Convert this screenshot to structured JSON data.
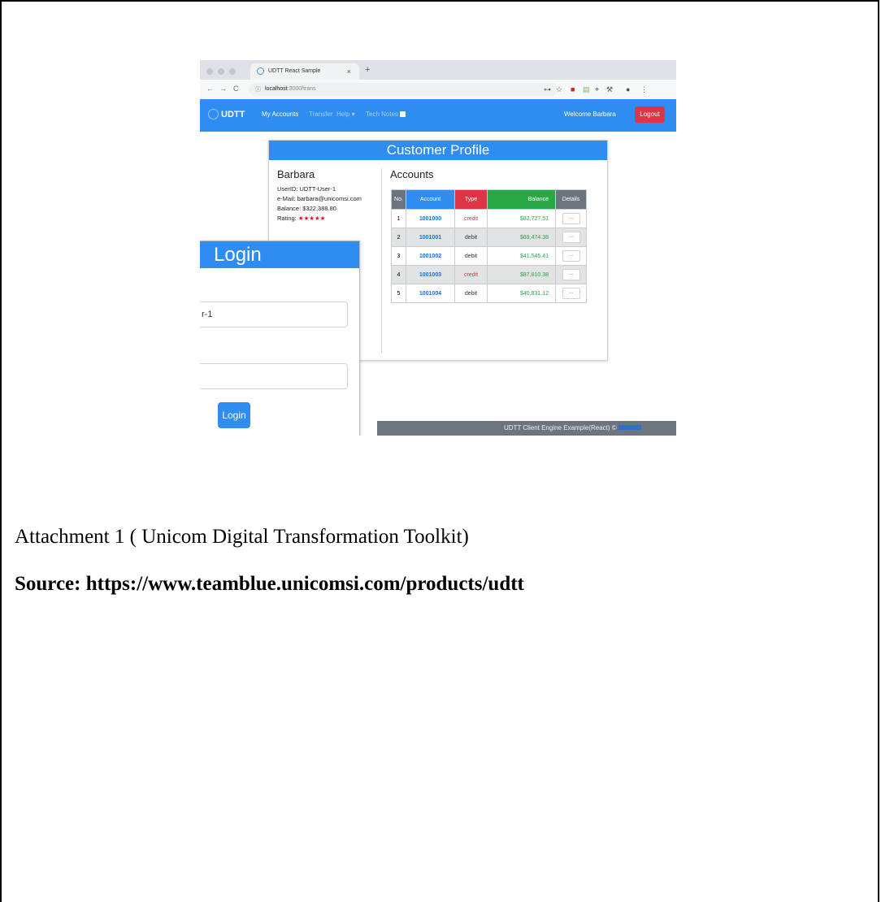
{
  "browser": {
    "tab_title": "UDTT React Sample",
    "tab_close": "×",
    "new_tab": "+",
    "nav_back": "←",
    "nav_forward": "→",
    "nav_reload": "C",
    "url_host": "localhost",
    "url_path": ":3000/trans",
    "ext_icons": [
      "key-icon",
      "star-icon",
      "extension-red-icon",
      "extension-doc-icon",
      "pin-icon",
      "tools-icon",
      "account-icon",
      "menu-icon"
    ]
  },
  "navbar": {
    "brand": "UDTT",
    "links": [
      "My Accounts",
      "Transfer",
      "Help ▾",
      "Tech Notes"
    ],
    "welcome": "Welcome Barbara",
    "logout": "Logout",
    "colors": {
      "primary": "#2f8cf0",
      "danger": "#dc3545"
    }
  },
  "profile": {
    "header": "Customer Profile",
    "name": "Barbara",
    "user_id": "UserID: UDTT-User-1",
    "email": "e-Mail: barbara@unicomsi.com",
    "balance": "Balance: $322,388.80",
    "rating_label": "Rating:",
    "rating_stars": "★★★★★",
    "rating_value": 5,
    "accounts_title": "Accounts",
    "table": {
      "headers": [
        "No.",
        "Account",
        "Type",
        "Balance",
        "Details"
      ],
      "rows": [
        {
          "no": "1",
          "account": "1001000",
          "type": "credit",
          "balance": "$82,727.51",
          "details": "..."
        },
        {
          "no": "2",
          "account": "1001001",
          "type": "debit",
          "balance": "$69,474.38",
          "details": "..."
        },
        {
          "no": "3",
          "account": "1001002",
          "type": "debit",
          "balance": "$41,545.41",
          "details": "..."
        },
        {
          "no": "4",
          "account": "1001003",
          "type": "credit",
          "balance": "$87,810.38",
          "details": "..."
        },
        {
          "no": "5",
          "account": "1001004",
          "type": "debit",
          "balance": "$40,831.12",
          "details": "..."
        }
      ]
    }
  },
  "login": {
    "header": "Login",
    "username_value": "r-1",
    "password_value": "",
    "button": "Login"
  },
  "footer": {
    "text": "UDTT Client Engine Example(React) ©"
  },
  "document": {
    "caption": "Attachment 1 ( Unicom Digital Transformation Toolkit)",
    "source": "Source: https://www.teamblue.unicomsi.com/products/udtt"
  }
}
